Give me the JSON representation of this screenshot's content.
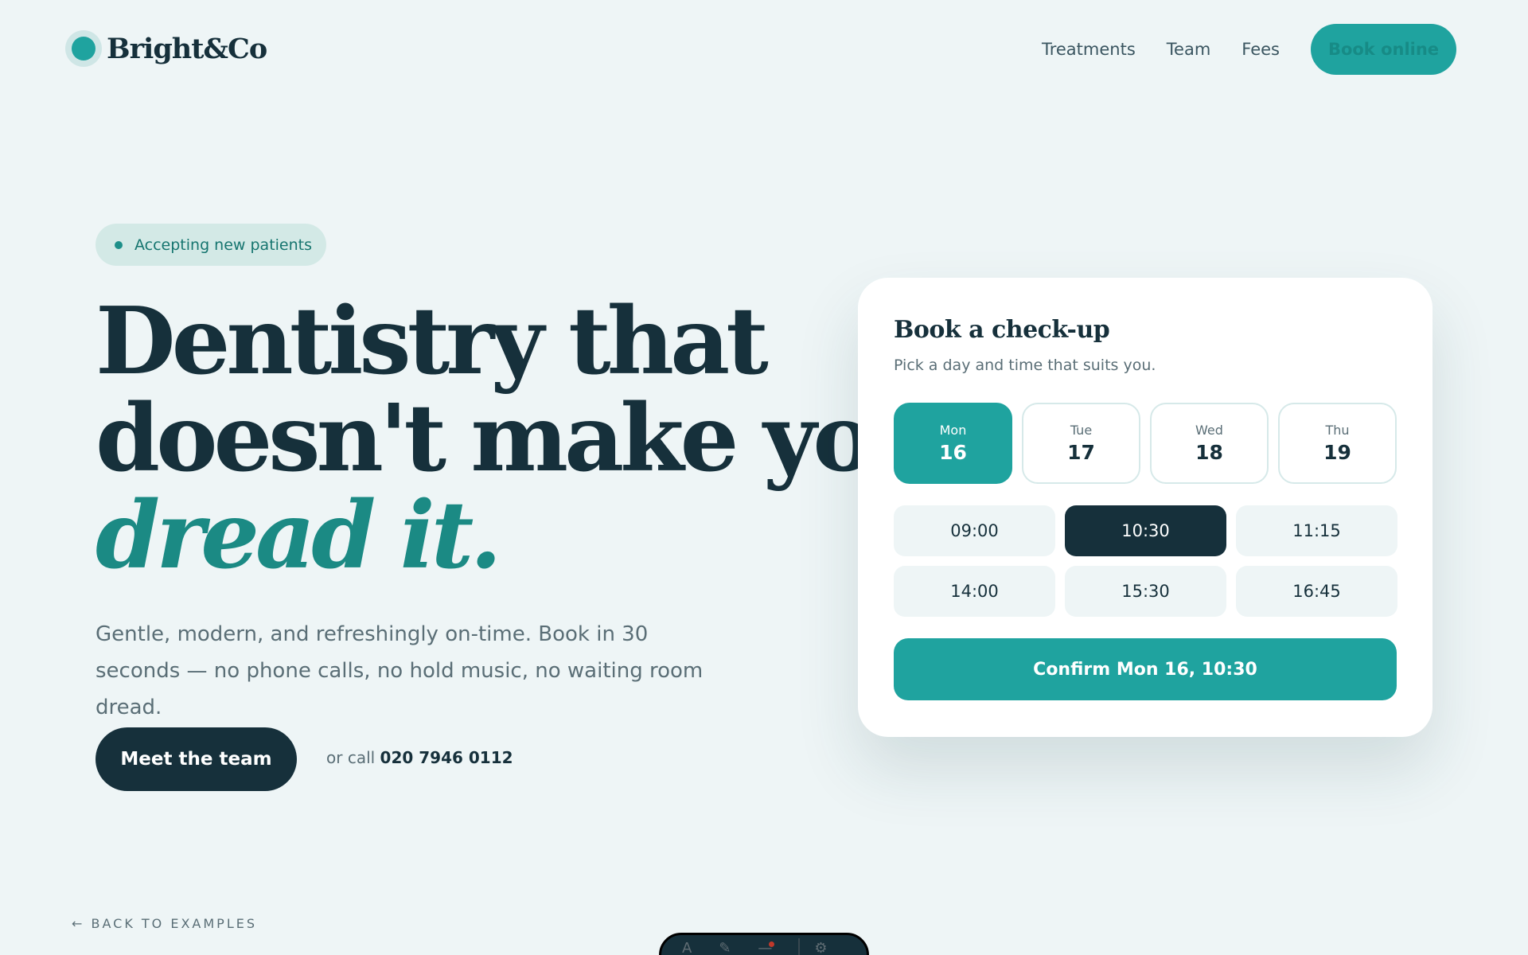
{
  "brand": {
    "name": "Bright&Co"
  },
  "nav": {
    "links": [
      "Treatments",
      "Team",
      "Fees"
    ],
    "book_label": "Book online"
  },
  "hero": {
    "badge": "Accepting new patients",
    "headline_line1": "Dentistry that",
    "headline_line2": "doesn't make you",
    "headline_accent": "dread it.",
    "lede": "Gentle, modern, and refreshingly on-time. Book in 30 seconds — no phone calls, no hold music, no waiting room dread.",
    "cta_label": "Meet the team",
    "call_prefix": "or call",
    "phone": "020 7946 0112"
  },
  "booking": {
    "title": "Book a check-up",
    "subtitle": "Pick a day and time that suits you.",
    "days": [
      {
        "name": "Mon",
        "num": "16",
        "selected": true
      },
      {
        "name": "Tue",
        "num": "17",
        "selected": false
      },
      {
        "name": "Wed",
        "num": "18",
        "selected": false
      },
      {
        "name": "Thu",
        "num": "19",
        "selected": false
      }
    ],
    "times": [
      {
        "label": "09:00",
        "selected": false
      },
      {
        "label": "10:30",
        "selected": true
      },
      {
        "label": "11:15",
        "selected": false
      },
      {
        "label": "14:00",
        "selected": false
      },
      {
        "label": "15:30",
        "selected": false
      },
      {
        "label": "16:45",
        "selected": false
      }
    ],
    "confirm_label": "Confirm Mon 16, 10:30"
  },
  "footer": {
    "back_label": "BACK TO EXAMPLES",
    "back_arrow": "←"
  },
  "colors": {
    "accent": "#1fa39f",
    "dark": "#16303b",
    "background": "#eef5f6"
  }
}
